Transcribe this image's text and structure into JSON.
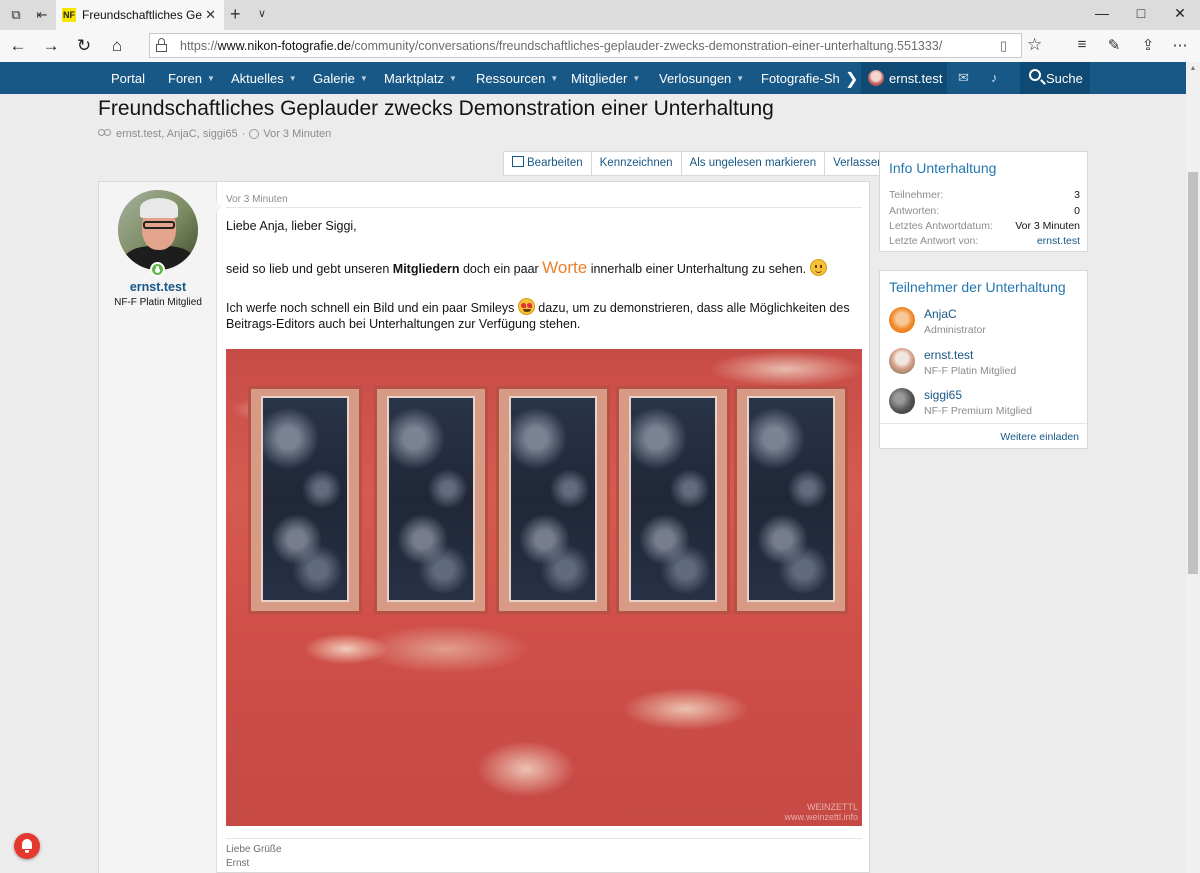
{
  "browser": {
    "tab_title": "Freundschaftliches Geplauder zwecks Demonstration einer Unterhaltung",
    "favicon_text": "NF",
    "url_prefix": "https://",
    "url_domain": "www.nikon-fotografie.de",
    "url_path": "/community/conversations/freundschaftliches-geplauder-zwecks-demonstration-einer-unterhaltung.551333/",
    "icons": [
      "tab-actions-icon",
      "set-aside-tabs-icon",
      "close-icon",
      "new-tab-icon",
      "chevron-down-icon",
      "minimize-icon",
      "maximize-icon",
      "close-window-icon",
      "back-icon",
      "forward-icon",
      "refresh-icon",
      "home-icon",
      "lock-icon",
      "reading-view-icon",
      "favorite-star-icon",
      "favorites-list-icon",
      "pen-icon",
      "share-icon",
      "more-icon"
    ]
  },
  "sitenav": {
    "items": [
      {
        "label": "Portal",
        "dropdown": false
      },
      {
        "label": "Foren",
        "dropdown": true
      },
      {
        "label": "Aktuelles",
        "dropdown": true
      },
      {
        "label": "Galerie",
        "dropdown": true
      },
      {
        "label": "Marktplatz",
        "dropdown": true
      },
      {
        "label": "Ressourcen",
        "dropdown": true
      },
      {
        "label": "Mitglieder",
        "dropdown": true
      },
      {
        "label": "Verlosungen",
        "dropdown": true
      },
      {
        "label": "Fotografie-Sh"
      }
    ],
    "user": "ernst.test",
    "search": "Suche"
  },
  "colors": {
    "nav_bg": "#185886",
    "link": "#185886",
    "accent_title": "#2577b1",
    "worte": "#e8822f"
  },
  "conversation": {
    "title": "Freundschaftliches Geplauder zwecks Demonstration einer Unterhaltung",
    "participants_meta": "ernst.test, AnjaC, siggi65",
    "separator": "·",
    "time_meta": "Vor 3 Minuten"
  },
  "actions": {
    "edit": "Bearbeiten",
    "mark": "Kennzeichnen",
    "unread": "Als ungelesen markieren",
    "leave": "Verlassen"
  },
  "post": {
    "author": "ernst.test",
    "rank": "NF-F Platin Mitglied",
    "time": "Vor 3 Minuten",
    "greeting": "Liebe Anja, lieber Siggi,",
    "line2_a": "seid so lieb und gebt unseren ",
    "line2_bold": "Mitgliedern",
    "line2_b": " doch ein paar ",
    "line2_big": "Worte",
    "line2_c": " innerhalb einer Unterhaltung zu sehen.",
    "line3_a": "Ich werfe noch schnell ein Bild und ein paar Smileys ",
    "line3_b": " dazu, um zu demonstrieren, dass alle Möglichkeiten des",
    "line4": "Beitrags-Editors auch bei Unterhaltungen zur Verfügung stehen.",
    "watermark_1": "WEINZETTL",
    "watermark_2": "www.weinzettl.info",
    "sig_1": "Liebe Grüße",
    "sig_2": "Ernst"
  },
  "info_block": {
    "title": "Info Unterhaltung",
    "rows": [
      {
        "k": "Teilnehmer:",
        "v": "3"
      },
      {
        "k": "Antworten:",
        "v": "0"
      },
      {
        "k": "Letztes Antwortdatum:",
        "v": "Vor 3 Minuten"
      },
      {
        "k": "Letzte Antwort von:",
        "v": "ernst.test"
      }
    ]
  },
  "participants_block": {
    "title": "Teilnehmer der Unterhaltung",
    "people": [
      {
        "name": "AnjaC",
        "role": "Administrator"
      },
      {
        "name": "ernst.test",
        "role": "NF-F Platin Mitglied"
      },
      {
        "name": "siggi65",
        "role": "NF-F Premium Mitglied"
      }
    ],
    "invite": "Weitere einladen"
  }
}
